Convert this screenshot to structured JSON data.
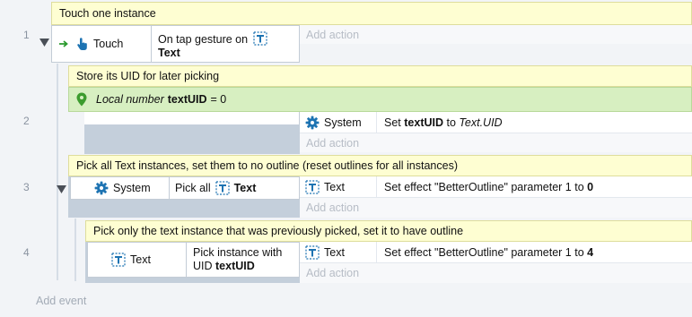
{
  "colors": {
    "comment_bg": "#fefed2",
    "local_var_bg": "#d7efc1",
    "accent_blue": "#1d73b2",
    "add_text": "#b7bdc6"
  },
  "events": [
    {
      "number": "1",
      "comment": "Touch one instance",
      "condition": {
        "object": "Touch",
        "object_icon": "touch-hand-icon",
        "text_prefix": "On tap gesture on",
        "target": "Text"
      },
      "add_action": "Add action"
    },
    {
      "number": "2",
      "comment": "Store its UID for later picking",
      "local_variable": {
        "kind": "Local number",
        "name": "textUID",
        "value": "= 0"
      },
      "action": {
        "object": "System",
        "object_icon": "gear-icon",
        "text_prefix": "Set",
        "var": "textUID",
        "text_middle": "to",
        "expr": "Text.UID"
      },
      "add_action": "Add action"
    },
    {
      "number": "3",
      "comment": "Pick all Text instances, set them to no outline (reset outlines for all instances)",
      "condition": {
        "object": "System",
        "object_icon": "gear-icon",
        "text_prefix": "Pick all",
        "target": "Text"
      },
      "action": {
        "object": "Text",
        "object_icon": "text-object-icon",
        "text": "Set effect \"BetterOutline\" parameter 1 to",
        "value": "0"
      },
      "add_action": "Add action"
    },
    {
      "number": "4",
      "comment": "Pick only the text instance that was previously picked, set it to have outline",
      "condition": {
        "object": "Text",
        "object_icon": "text-object-icon",
        "line1": "Pick instance with",
        "line2_prefix": "UID",
        "var": "textUID"
      },
      "action": {
        "object": "Text",
        "object_icon": "text-object-icon",
        "text": "Set effect \"BetterOutline\" parameter 1 to",
        "value": "4"
      },
      "add_action": "Add action"
    }
  ],
  "add_event": "Add event"
}
